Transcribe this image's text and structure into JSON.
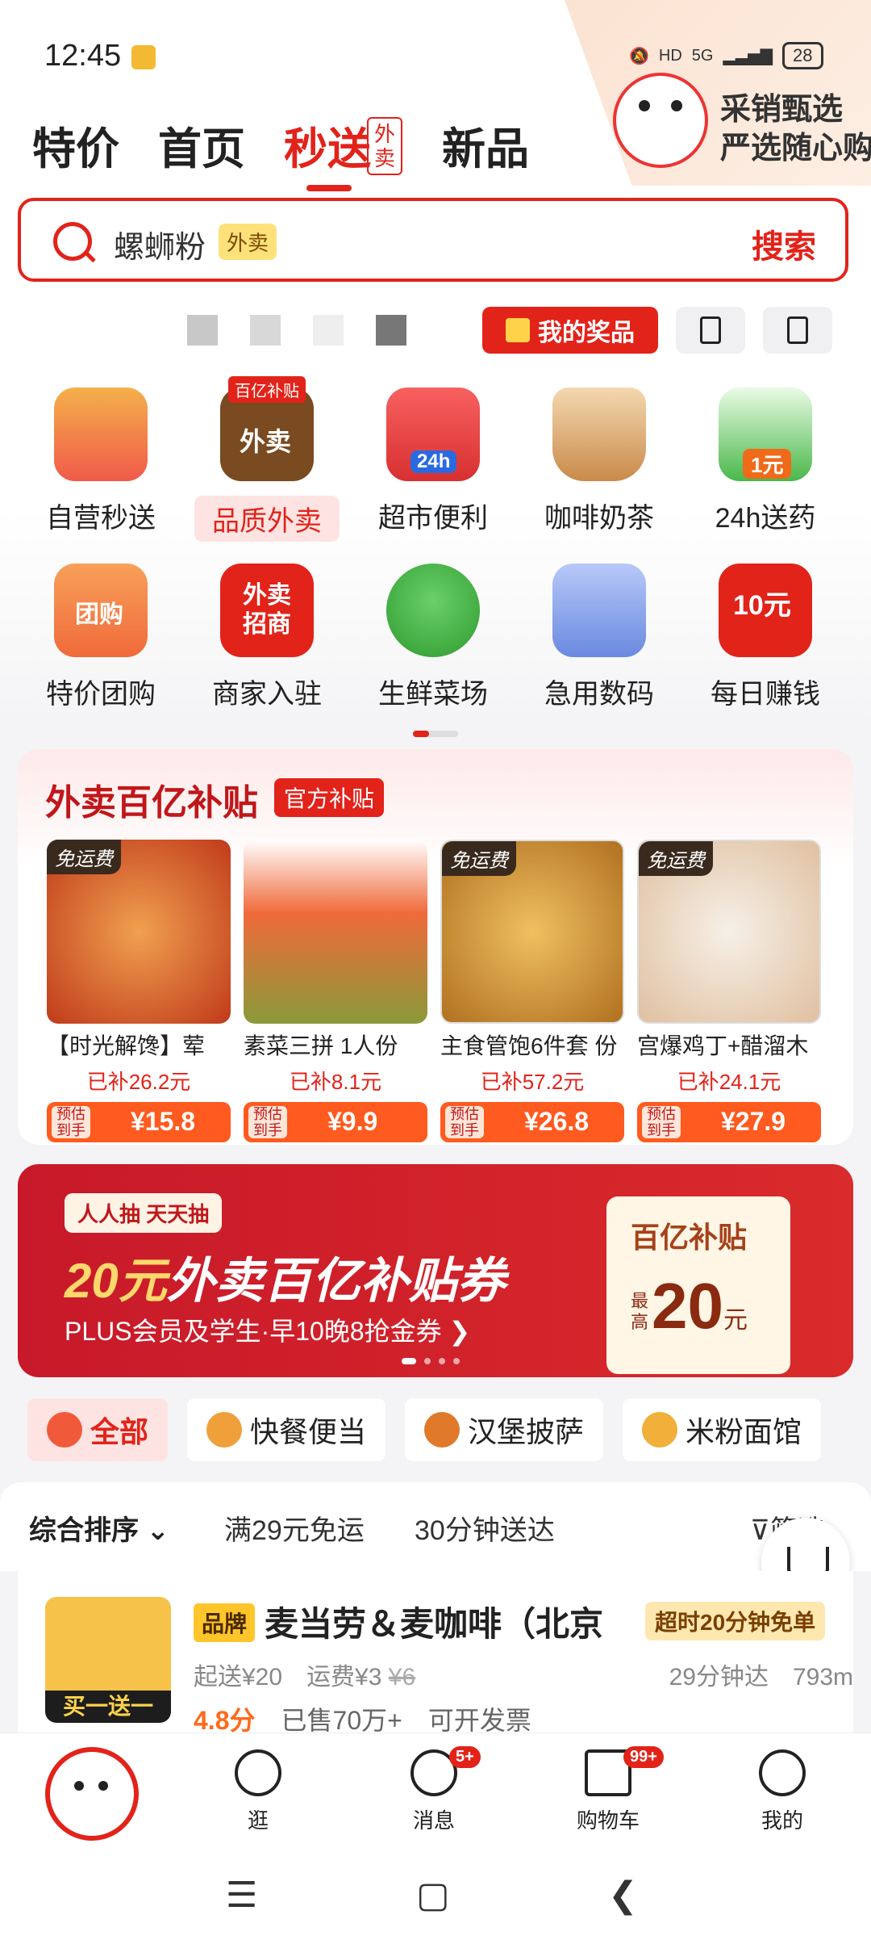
{
  "status_bar": {
    "time": "12:45",
    "network": "5G",
    "hd": "HD",
    "battery": "28"
  },
  "promo_corner": {
    "line1": "采销甄选",
    "line2": "严选随心购"
  },
  "tabs": [
    {
      "label": "特价"
    },
    {
      "label": "首页"
    },
    {
      "label": "秒送",
      "badge": "外卖",
      "active": true
    },
    {
      "label": "新品"
    }
  ],
  "search": {
    "query": "螺蛳粉",
    "tag": "外卖",
    "button": "搜索"
  },
  "quick": {
    "prize_label": "我的奖品"
  },
  "categories": [
    {
      "label": "自营秒送",
      "icon": "basket-icon",
      "color": "#f05a4a"
    },
    {
      "label": "品质外卖",
      "icon": "takeout-bag-icon",
      "color": "#7a4a20",
      "highlight": true,
      "ribbon": "百亿补贴",
      "icon_text": "外卖"
    },
    {
      "label": "超市便利",
      "icon": "store-icon",
      "color": "#f04a4a",
      "icon_text": "24h"
    },
    {
      "label": "咖啡奶茶",
      "icon": "coffee-cup-icon",
      "color": "#c98a4a"
    },
    {
      "label": "24h送药",
      "icon": "medicine-icon",
      "color": "#4ab84a",
      "icon_text": "1元"
    },
    {
      "label": "特价团购",
      "icon": "group-buy-ticket-icon",
      "color": "#f06a3a",
      "icon_text": "团购"
    },
    {
      "label": "商家入驻",
      "icon": "merchant-bag-icon",
      "color": "#e2231a",
      "icon_text": "外卖招商"
    },
    {
      "label": "生鲜菜场",
      "icon": "broccoli-icon",
      "color": "#4ab84a"
    },
    {
      "label": "急用数码",
      "icon": "phone-cable-icon",
      "color": "#6a8ae0"
    },
    {
      "label": "每日赚钱",
      "icon": "red-envelope-icon",
      "color": "#e2231a",
      "icon_text": "10元"
    }
  ],
  "subsidy": {
    "title": "外卖百亿补贴",
    "tag": "官方补贴",
    "products": [
      {
        "name": "【时光解馋】荤",
        "subsidy": "已补26.2元",
        "pre_label": "预估到手",
        "price": "¥15.8",
        "free_ship": "免运费",
        "color": "#d9733a"
      },
      {
        "name": "素菜三拼 1人份",
        "subsidy": "已补8.1元",
        "pre_label": "预估到手",
        "price": "¥9.9",
        "free_ship": "",
        "color": "#8a9a3a"
      },
      {
        "name": "主食管饱6件套 份",
        "subsidy": "已补57.2元",
        "pre_label": "预估到手",
        "price": "¥26.8",
        "free_ship": "免运费",
        "color": "#d9a03a"
      },
      {
        "name": "宫爆鸡丁+醋溜木",
        "subsidy": "已补24.1元",
        "pre_label": "预估到手",
        "price": "¥27.9",
        "free_ship": "免运费",
        "color": "#e0c0a0"
      }
    ]
  },
  "banner": {
    "tag": "人人抽 天天抽",
    "title_amount": "20元",
    "title_rest": "外卖百亿补贴券",
    "subtitle": "PLUS会员及学生·早10晚8抢金券",
    "coupon_title": "百亿补贴",
    "coupon_prefix": "最高",
    "coupon_value": "20",
    "coupon_unit": "元"
  },
  "chips": [
    {
      "label": "全部",
      "icon": "meishi-icon",
      "active": true,
      "color": "#f05a3a"
    },
    {
      "label": "快餐便当",
      "icon": "bento-icon",
      "color": "#f0a03a"
    },
    {
      "label": "汉堡披萨",
      "icon": "burger-icon",
      "color": "#e07a2a"
    },
    {
      "label": "米粉面馆",
      "icon": "noodle-icon",
      "color": "#f0b03a"
    }
  ],
  "sort": {
    "primary": "综合排序",
    "free_ship": "满29元免运",
    "fast": "30分钟送达",
    "filter": "筛选"
  },
  "store": {
    "brand": "品牌",
    "name": "麦当劳＆麦咖啡（北京",
    "badge": "超时20分钟免单",
    "img_text": "买一送一",
    "min_order": "起送¥20",
    "delivery_fee": "运费¥3",
    "orig_fee": "¥6",
    "eta": "29分钟达",
    "distance": "793m",
    "rating": "4.8分",
    "sold": "已售70万+",
    "invoice": "可开发票"
  },
  "bottom_nav": [
    {
      "label": "逛",
      "icon": "face-icon"
    },
    {
      "label": "消息",
      "icon": "chat-icon",
      "badge": "5+"
    },
    {
      "label": "购物车",
      "icon": "cart-icon",
      "badge": "99+"
    },
    {
      "label": "我的",
      "icon": "user-icon"
    }
  ]
}
